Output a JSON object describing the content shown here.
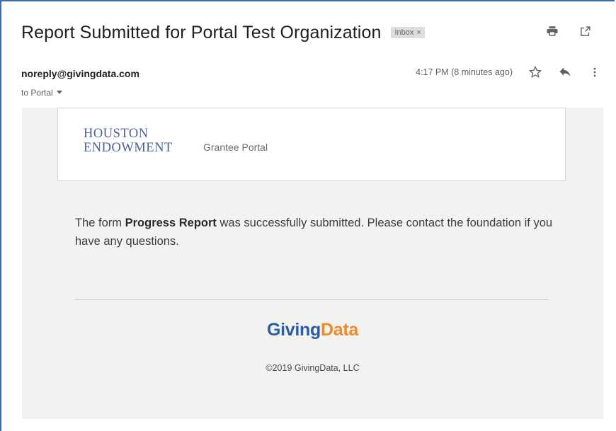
{
  "email": {
    "subject": "Report Submitted for Portal Test Organization",
    "label": "Inbox",
    "label_remove": "×",
    "sender": "noreply@givingdata.com",
    "to_line": "to Portal",
    "time": "4:17 PM (8 minutes ago)"
  },
  "icons": {
    "print": "print-icon",
    "open_new_window": "open-in-new-window-icon",
    "star": "star-icon",
    "reply": "reply-icon",
    "more": "more-vertical-icon",
    "dropdown": "caret-down-icon"
  },
  "body": {
    "org_logo_line1": "HOUSTON",
    "org_logo_line2": "ENDOWMENT",
    "portal_label": "Grantee Portal",
    "message_pre": "The form ",
    "message_bold": "Progress Report",
    "message_post": " was successfully submitted. Please contact the foundation if you have any questions.",
    "footer_logo_part1": "Giving",
    "footer_logo_part2": "Data",
    "copyright": "©2019 GivingData, LLC"
  },
  "colors": {
    "frame_accent": "#3f6bb4",
    "logo_blue": "#4a5f9e",
    "givingdata_blue": "#2c5da8",
    "givingdata_orange": "#ef8a2b",
    "body_bg": "#f2f2f0"
  }
}
